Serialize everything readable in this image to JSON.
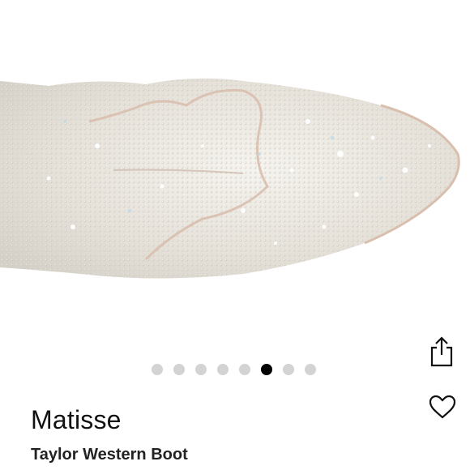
{
  "product": {
    "image_alt": "Silver rhinestone-embellished western boot toe",
    "brand": "Matisse",
    "name": "Taylor Western Boot"
  },
  "carousel": {
    "total": 8,
    "active_index": 5
  },
  "icons": {
    "share": "share-icon",
    "like": "heart-icon"
  },
  "colors": {
    "dot_active": "#000000",
    "dot_inactive": "#d3d3d3",
    "boot_base": "#e9e6df",
    "piping": "#d9bfae"
  }
}
